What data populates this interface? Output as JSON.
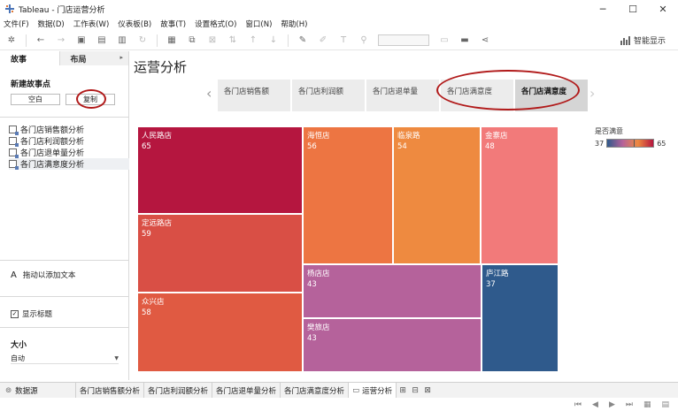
{
  "window": {
    "title": "Tableau - 门店运营分析",
    "minimize": "─",
    "maximize": "☐",
    "close": "✕"
  },
  "menu": [
    "文件(F)",
    "数据(D)",
    "工作表(W)",
    "仪表板(B)",
    "故事(T)",
    "设置格式(O)",
    "窗口(N)",
    "帮助(H)"
  ],
  "toolbar": {
    "smart_show": "智能显示"
  },
  "left_panel": {
    "tab_story": "故事",
    "tab_layout": "布局",
    "new_story_point": "新建故事点",
    "blank_button": "空白",
    "copy_button": "复制",
    "sheets": [
      "各门店销售额分析",
      "各门店利润额分析",
      "各门店退单量分析",
      "各门店满意度分析"
    ],
    "drag_text": "拖动以添加文本",
    "show_title": "显示标题",
    "size_label": "大小",
    "size_value": "自动"
  },
  "story": {
    "title": "运营分析",
    "points": [
      "各门店销售额",
      "各门店利润额",
      "各门店退单量",
      "各门店满意度",
      "各门店满意度"
    ],
    "active_index": 4
  },
  "chart_data": {
    "type": "treemap",
    "measure": "是否满意",
    "cells": [
      {
        "name": "人民路店",
        "value": 65,
        "color": "#b5163f"
      },
      {
        "name": "定远路店",
        "value": 59,
        "color": "#d94f45"
      },
      {
        "name": "众兴店",
        "value": 58,
        "color": "#e05a42"
      },
      {
        "name": "海恒店",
        "value": 56,
        "color": "#ed7542"
      },
      {
        "name": "临泉路",
        "value": 54,
        "color": "#ee8a40"
      },
      {
        "name": "金寨店",
        "value": 48,
        "color": "#f27a7a"
      },
      {
        "name": "杨店店",
        "value": 43,
        "color": "#b5629b"
      },
      {
        "name": "樊旅店",
        "value": 43,
        "color": "#b5629b"
      },
      {
        "name": "庐江路",
        "value": 37,
        "color": "#2f5a8c"
      }
    ],
    "legend": {
      "title": "是否满意",
      "min": "37",
      "max": "65",
      "colors": [
        "#2f5a8c",
        "#b5629b",
        "#ee8a40",
        "#b5163f"
      ]
    }
  },
  "bottom_tabs": {
    "data_source": "数据源",
    "sheets": [
      "各门店销售额分析",
      "各门店利润额分析",
      "各门店退单量分析",
      "各门店满意度分析"
    ],
    "story": "运营分析"
  }
}
